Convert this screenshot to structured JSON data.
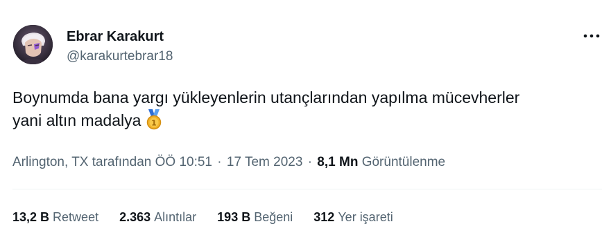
{
  "author": {
    "name": "Ebrar Karakurt",
    "handle": "@karakurtebrar18"
  },
  "tweet": {
    "text_line1": "Boynumda bana yargı yükleyenlerin utançlarından yapılma mücevherler",
    "text_line2": "yani altın madalya",
    "emoji": "first-place-medal-icon"
  },
  "meta": {
    "location": "Arlington, TX tarafından",
    "time": "ÖÖ 10:51",
    "separator": "·",
    "date": "17 Tem 2023",
    "views_count": "8,1 Mn",
    "views_label": "Görüntülenme"
  },
  "stats": {
    "retweets_count": "13,2 B",
    "retweets_label": "Retweet",
    "quotes_count": "2.363",
    "quotes_label": "Alıntılar",
    "likes_count": "193 B",
    "likes_label": "Beğeni",
    "bookmarks_count": "312",
    "bookmarks_label": "Yer işareti"
  },
  "colors": {
    "text_primary": "#0f1419",
    "text_secondary": "#536471",
    "divider": "#eff3f4"
  }
}
